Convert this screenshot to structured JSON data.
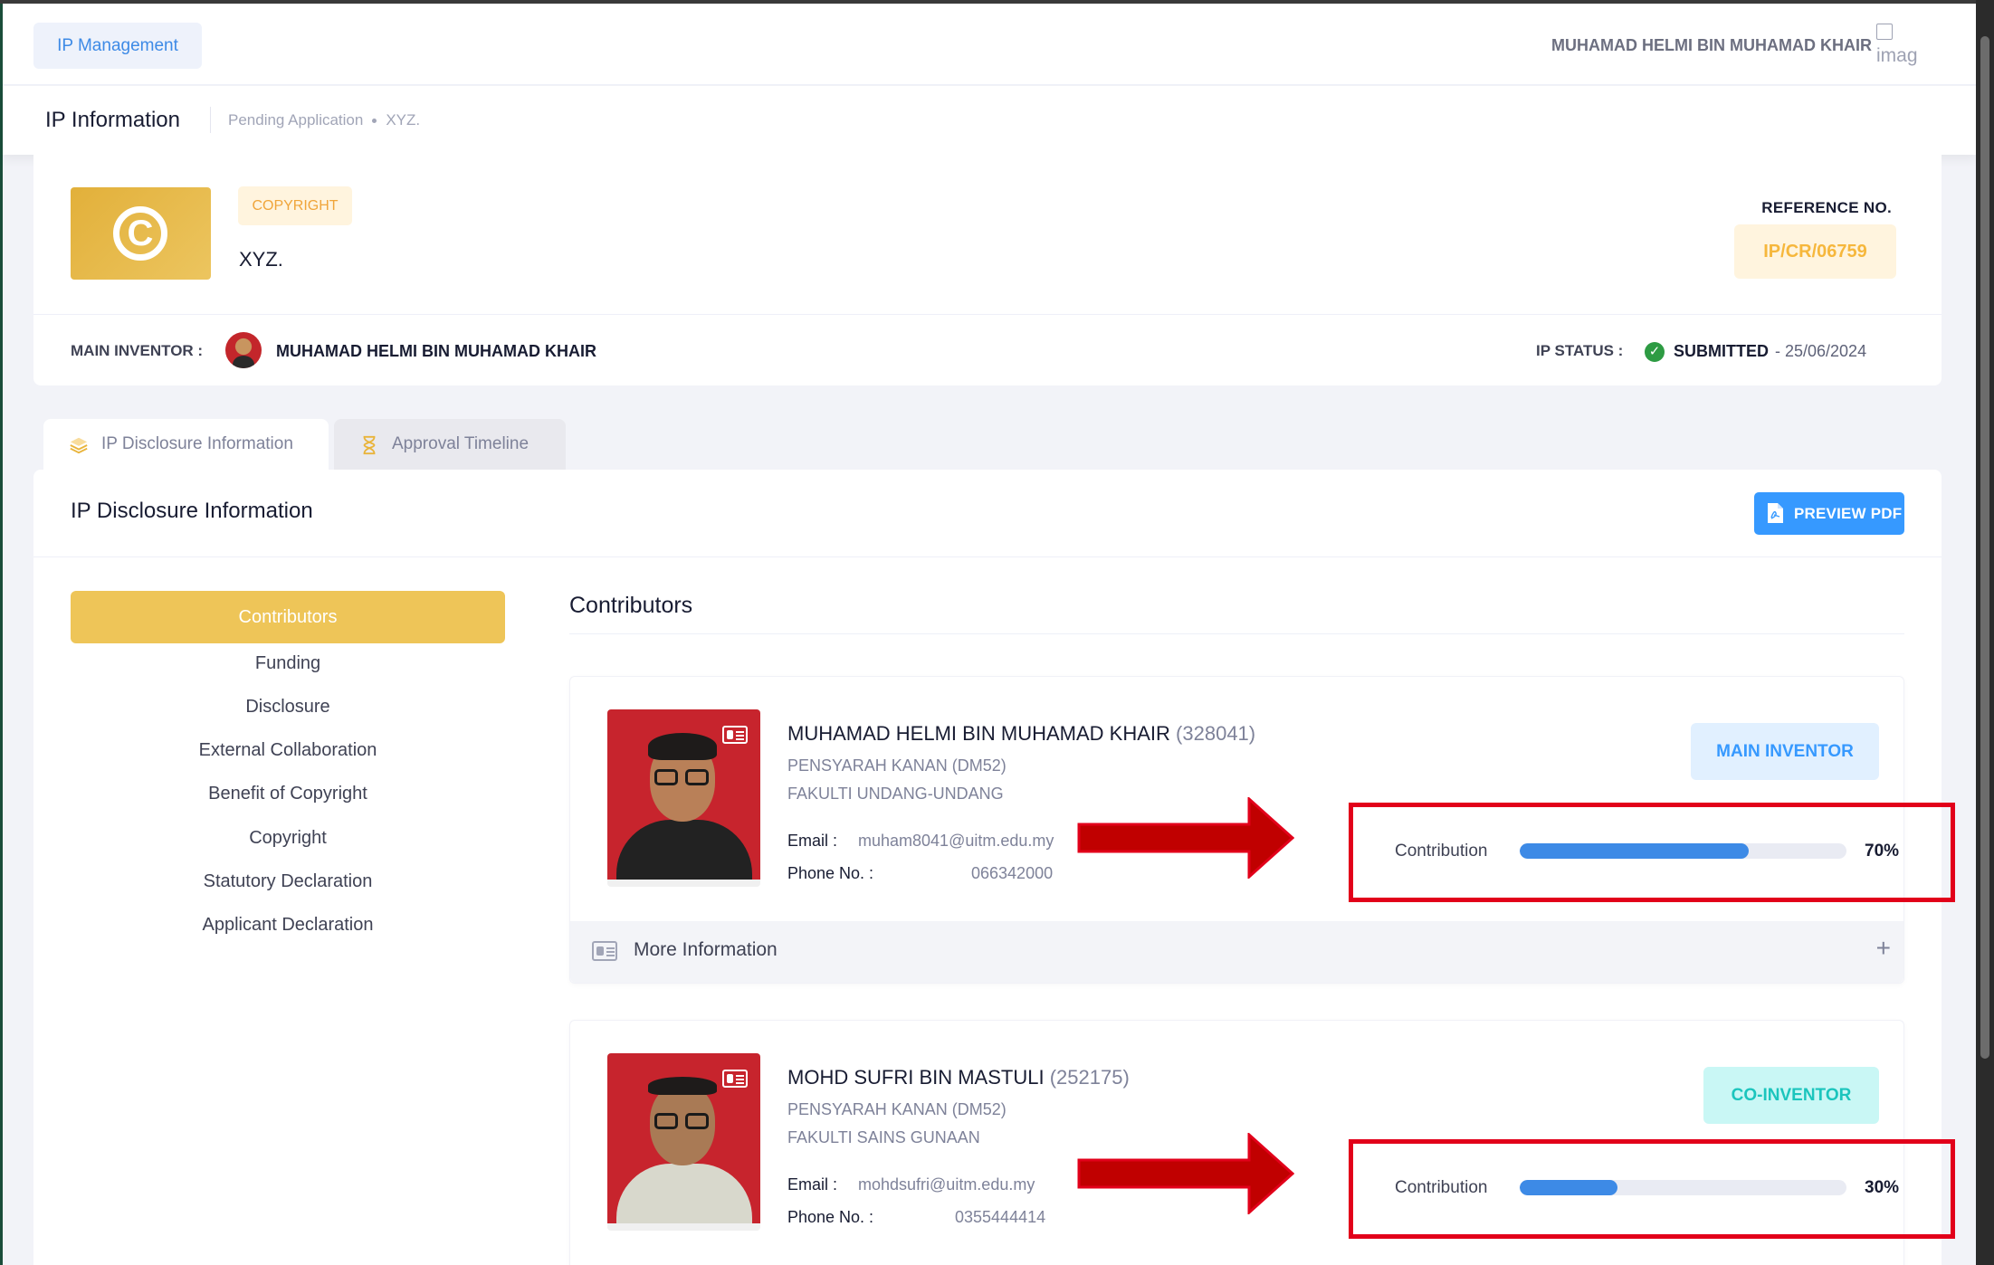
{
  "header": {
    "app_button": "IP Management",
    "user_name": "MUHAMAD HELMI BIN MUHAMAD KHAIR",
    "user_image_alt": "imag"
  },
  "subheader": {
    "title": "IP Information",
    "breadcrumbs": [
      "Pending Application",
      "XYZ."
    ]
  },
  "ip": {
    "type_badge": "COPYRIGHT",
    "title": "XYZ.",
    "reference_label": "REFERENCE NO.",
    "reference_no": "IP/CR/06759",
    "main_inventor_label": "MAIN INVENTOR :",
    "main_inventor_name": "MUHAMAD HELMI BIN MUHAMAD KHAIR",
    "status_label": "IP STATUS :",
    "status": "SUBMITTED",
    "status_date": "- 25/06/2024"
  },
  "tabs": [
    {
      "label": "IP Disclosure Information",
      "active": true
    },
    {
      "label": "Approval Timeline",
      "active": false
    }
  ],
  "section": {
    "title": "IP Disclosure Information",
    "preview_button": "PREVIEW PDF"
  },
  "side_nav": {
    "active": "Contributors",
    "items": [
      "Funding",
      "Disclosure",
      "External Collaboration",
      "Benefit of Copyright",
      "Copyright",
      "Statutory Declaration",
      "Applicant Declaration"
    ]
  },
  "contributors": {
    "title": "Contributors",
    "email_label": "Email :",
    "phone_label": "Phone No. :",
    "contribution_label": "Contribution",
    "more_info_label": "More Information",
    "people": [
      {
        "name": "MUHAMAD HELMI BIN MUHAMAD KHAIR",
        "staff_no": "(328041)",
        "position": "PENSYARAH KANAN (DM52)",
        "faculty": "FAKULTI UNDANG-UNDANG",
        "email": "muham8041@uitm.edu.my",
        "phone": "066342000",
        "role": "MAIN INVENTOR",
        "contribution_pct": 70,
        "contribution_text": "70%"
      },
      {
        "name": "MOHD SUFRI BIN MASTULI",
        "staff_no": "(252175)",
        "position": "PENSYARAH KANAN (DM52)",
        "faculty": "FAKULTI SAINS GUNAAN",
        "email": "mohdsufri@uitm.edu.my",
        "phone": "0355444414",
        "role": "CO-INVENTOR",
        "contribution_pct": 30,
        "contribution_text": "30%"
      }
    ]
  },
  "colors": {
    "accent_blue": "#3699ff",
    "nav_active": "#eec558",
    "highlight_red": "#e2001a",
    "status_green": "#2d9b43"
  }
}
